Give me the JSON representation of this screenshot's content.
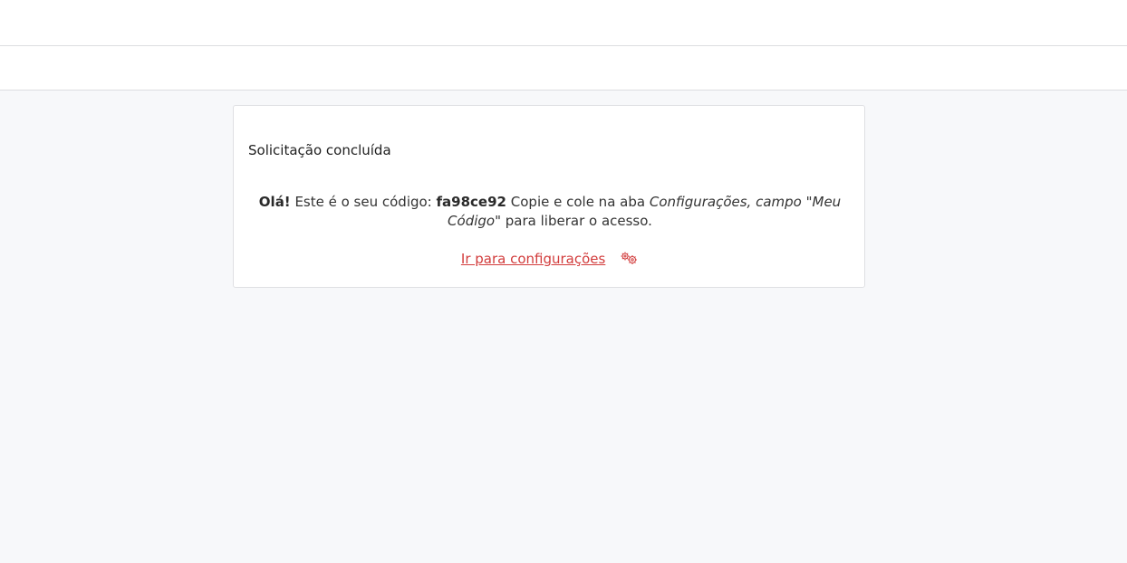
{
  "card": {
    "title": "Solicitação concluída",
    "greeting": "Olá!",
    "intro": "Este é o seu código:",
    "code": "fa98ce92",
    "instruction": "Copie e cole na aba",
    "location": "Configurações, campo \"Meu Código\"",
    "suffix": "para liberar o acesso.",
    "link_label": "Ir para configurações",
    "link_icon": "gears-icon"
  },
  "colors": {
    "link": "#d23c3c",
    "page_background": "#f7f8fa"
  }
}
